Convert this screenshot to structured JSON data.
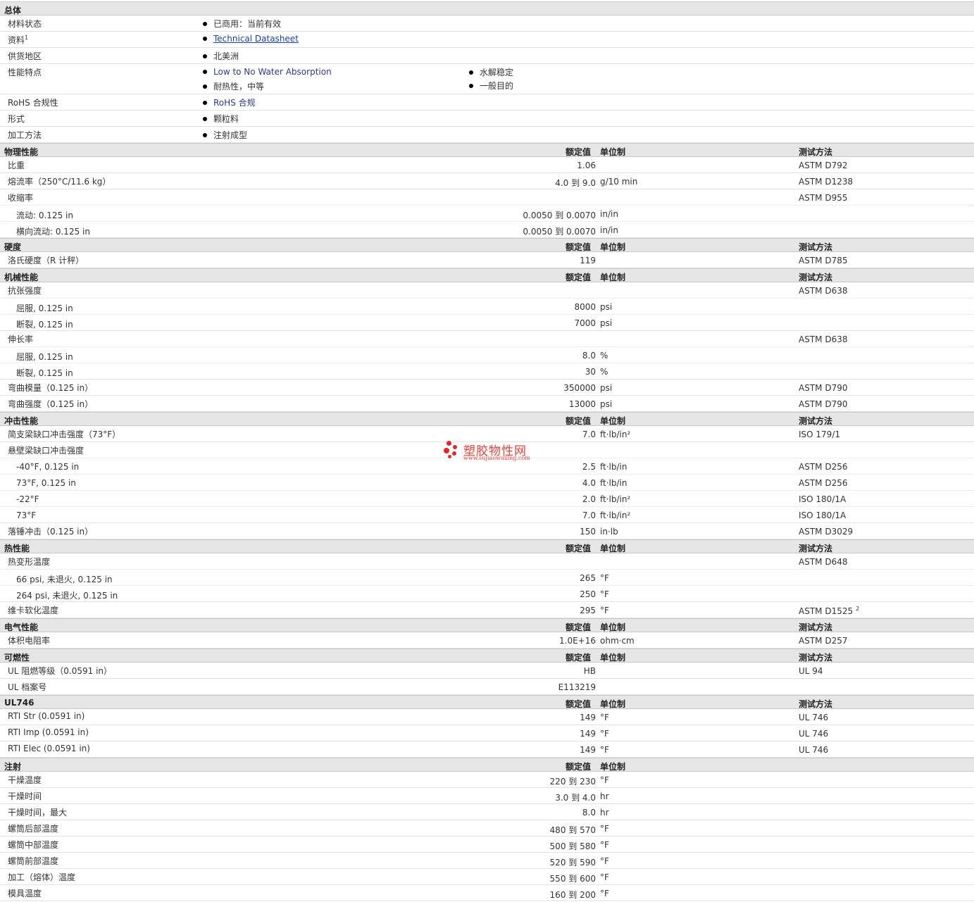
{
  "general": {
    "title": "总体",
    "rows": [
      {
        "label": "材料状态",
        "items": [
          "已商用：当前有效"
        ]
      },
      {
        "label": "资料",
        "sup": "1",
        "items": [
          "Technical Datasheet"
        ],
        "link": true
      },
      {
        "label": "供货地区",
        "items": [
          "北美洲"
        ]
      },
      {
        "label": "性能特点",
        "items": [
          "Low to No Water Absorption",
          "水解稳定",
          "耐热性，中等",
          "一般目的"
        ]
      },
      {
        "label": "RoHS 合规性",
        "items": [
          "RoHS 合规"
        ]
      },
      {
        "label": "形式",
        "items": [
          "颗粒料"
        ]
      },
      {
        "label": "加工方法",
        "items": [
          "注射成型"
        ]
      }
    ]
  },
  "columns": {
    "value": "额定值",
    "unit": "单位制",
    "method": "测试方法"
  },
  "sections": [
    {
      "title": "物理性能",
      "rows": [
        {
          "label": "比重",
          "value": "1.06",
          "unit": "",
          "method": "ASTM D792"
        },
        {
          "label": "熔流率（250°C/11.6 kg）",
          "value": "4.0 到  9.0",
          "unit": "g/10 min",
          "method": "ASTM D1238"
        },
        {
          "label": "收缩率",
          "value": "",
          "unit": "",
          "method": "ASTM D955"
        },
        {
          "label": "流动: 0.125 in",
          "indent": true,
          "value": "0.0050 到  0.0070",
          "unit": "in/in",
          "method": ""
        },
        {
          "label": "横向流动: 0.125 in",
          "indent": true,
          "value": "0.0050 到  0.0070",
          "unit": "in/in",
          "method": ""
        }
      ]
    },
    {
      "title": "硬度",
      "rows": [
        {
          "label": "洛氏硬度（R 计秤）",
          "value": "119",
          "unit": "",
          "method": "ASTM D785"
        }
      ]
    },
    {
      "title": "机械性能",
      "rows": [
        {
          "label": "抗张强度",
          "value": "",
          "unit": "",
          "method": "ASTM D638"
        },
        {
          "label": "屈服, 0.125 in",
          "indent": true,
          "value": "8000",
          "unit": "psi",
          "method": ""
        },
        {
          "label": "断裂, 0.125 in",
          "indent": true,
          "value": "7000",
          "unit": "psi",
          "method": ""
        },
        {
          "label": "伸长率",
          "value": "",
          "unit": "",
          "method": "ASTM D638"
        },
        {
          "label": "屈服, 0.125 in",
          "indent": true,
          "value": "8.0",
          "unit": "%",
          "method": ""
        },
        {
          "label": "断裂, 0.125 in",
          "indent": true,
          "value": "30",
          "unit": "%",
          "method": ""
        },
        {
          "label": "弯曲模量（0.125 in）",
          "value": "350000",
          "unit": "psi",
          "method": "ASTM D790"
        },
        {
          "label": "弯曲强度（0.125 in）",
          "value": "13000",
          "unit": "psi",
          "method": "ASTM D790"
        }
      ]
    },
    {
      "title": "冲击性能",
      "rows": [
        {
          "label": "简支梁缺口冲击强度（73°F）",
          "value": "7.0",
          "unit": "ft·lb/in²",
          "method": "ISO 179/1"
        },
        {
          "label": "悬壁梁缺口冲击强度",
          "value": "",
          "unit": "",
          "method": ""
        },
        {
          "label": "-40°F, 0.125 in",
          "indent": true,
          "value": "2.5",
          "unit": "ft·lb/in",
          "method": "ASTM D256"
        },
        {
          "label": "73°F, 0.125 in",
          "indent": true,
          "value": "4.0",
          "unit": "ft·lb/in",
          "method": "ASTM D256"
        },
        {
          "label": "-22°F",
          "indent": true,
          "value": "2.0",
          "unit": "ft·lb/in²",
          "method": "ISO 180/1A"
        },
        {
          "label": "73°F",
          "indent": true,
          "value": "7.0",
          "unit": "ft·lb/in²",
          "method": "ISO 180/1A"
        },
        {
          "label": "落锤冲击（0.125 in）",
          "value": "150",
          "unit": "in·lb",
          "method": "ASTM D3029"
        }
      ]
    },
    {
      "title": "热性能",
      "rows": [
        {
          "label": "热变形温度",
          "value": "",
          "unit": "",
          "method": "ASTM D648"
        },
        {
          "label": "66 psi, 未退火, 0.125 in",
          "indent": true,
          "value": "265",
          "unit": "°F",
          "method": ""
        },
        {
          "label": "264 psi, 未退火, 0.125 in",
          "indent": true,
          "value": "250",
          "unit": "°F",
          "method": ""
        },
        {
          "label": "维卡软化温度",
          "value": "295",
          "unit": "°F",
          "method": "ASTM D1525",
          "msup": "2"
        }
      ]
    },
    {
      "title": "电气性能",
      "rows": [
        {
          "label": "体积电阻率",
          "value": "1.0E+16",
          "unit": "ohm·cm",
          "method": "ASTM D257"
        }
      ]
    },
    {
      "title": "可燃性",
      "rows": [
        {
          "label": "UL 阻燃等级（0.0591 in）",
          "value": "HB",
          "unit": "",
          "method": "UL 94"
        },
        {
          "label": "UL 档案号",
          "value": "E113219",
          "unit": "",
          "method": ""
        }
      ]
    },
    {
      "title": "UL746",
      "rows": [
        {
          "label": "RTI Str (0.0591 in)",
          "value": "149",
          "unit": "°F",
          "method": "UL 746"
        },
        {
          "label": "RTI Imp (0.0591 in)",
          "value": "149",
          "unit": "°F",
          "method": "UL 746"
        },
        {
          "label": "RTI Elec (0.0591 in)",
          "value": "149",
          "unit": "°F",
          "method": "UL 746"
        }
      ]
    },
    {
      "title": "注射",
      "nomethod": true,
      "rows": [
        {
          "label": "干燥温度",
          "value": "220 到  230",
          "unit": "°F",
          "method": ""
        },
        {
          "label": "干燥时间",
          "value": "3.0 到  4.0",
          "unit": "hr",
          "method": ""
        },
        {
          "label": "干燥时间，最大",
          "value": "8.0",
          "unit": "hr",
          "method": ""
        },
        {
          "label": "螺筒后部温度",
          "value": "480 到  570",
          "unit": "°F",
          "method": ""
        },
        {
          "label": "螺筒中部温度",
          "value": "500 到  580",
          "unit": "°F",
          "method": ""
        },
        {
          "label": "螺筒前部温度",
          "value": "520 到  590",
          "unit": "°F",
          "method": ""
        },
        {
          "label": "加工（熔体）温度",
          "value": "550 到  600",
          "unit": "°F",
          "method": ""
        },
        {
          "label": "模具温度",
          "value": "160 到  200",
          "unit": "°F",
          "method": ""
        }
      ]
    }
  ],
  "watermark": {
    "text": "塑胶物性网",
    "url": "www.sujiaowuxing.com"
  },
  "colors": {
    "header_bg": "#e6e6e6",
    "link": "#1a3fa8",
    "watermark": "#e3262a"
  }
}
